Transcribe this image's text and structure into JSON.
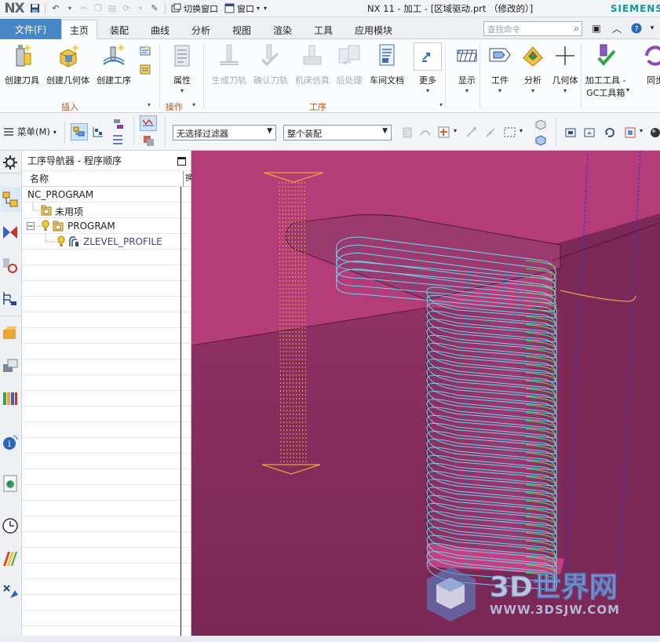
{
  "app": {
    "logo": "NX",
    "window_title": "NX 11 - 加工 - [区域驱动.prt （修改的）]",
    "brand": "SIEMENS"
  },
  "quick_access": {
    "switch_window": "切换窗口",
    "window_menu": "窗口"
  },
  "tabs": {
    "file": "文件(F)",
    "items": [
      "主页",
      "装配",
      "曲线",
      "分析",
      "视图",
      "渲染",
      "工具",
      "应用模块"
    ],
    "active": "主页"
  },
  "command_search": {
    "placeholder": "查找命令"
  },
  "ribbon": {
    "buttons": [
      {
        "label": "创建刀具",
        "icon": "create-tool-icon",
        "enabled": true
      },
      {
        "label": "创建几何体",
        "icon": "create-geometry-icon",
        "enabled": true
      },
      {
        "label": "创建工序",
        "icon": "create-operation-icon",
        "enabled": true
      },
      {
        "label": "属性",
        "icon": "properties-icon",
        "enabled": true
      },
      {
        "label": "生成刀轨",
        "icon": "generate-toolpath-icon",
        "enabled": false
      },
      {
        "label": "确认刀轨",
        "icon": "verify-toolpath-icon",
        "enabled": false
      },
      {
        "label": "机床仿真",
        "icon": "machine-simulation-icon",
        "enabled": false
      },
      {
        "label": "后处理",
        "icon": "postprocess-icon",
        "enabled": false
      },
      {
        "label": "车间文档",
        "icon": "shop-documentation-icon",
        "enabled": true
      },
      {
        "label": "更多",
        "icon": "more-icon",
        "enabled": true
      },
      {
        "label": "显示",
        "icon": "display-icon",
        "enabled": true
      },
      {
        "label": "工件",
        "icon": "workpiece-icon",
        "enabled": true
      },
      {
        "label": "分析",
        "icon": "analysis-icon",
        "enabled": true
      },
      {
        "label": "几何体",
        "icon": "geometry-icon",
        "enabled": true
      },
      {
        "label": "加工工具 -",
        "label2": "GC工具箱",
        "icon": "gc-toolbox-icon",
        "enabled": true
      },
      {
        "label": "同步",
        "icon": "sync-icon",
        "enabled": true
      }
    ],
    "groups": {
      "insert": "插入",
      "operations": "操作",
      "operation": "工序"
    }
  },
  "selection_bar": {
    "menu": "菜单(M)",
    "filter": "无选择过滤器",
    "scope": "整个装配"
  },
  "navigator": {
    "title": "工序导航器 - 程序顺序",
    "column_name": "名称",
    "column_2": "换",
    "rows": [
      {
        "label": "NC_PROGRAM",
        "indent": 0,
        "icon": "none"
      },
      {
        "label": "未用项",
        "indent": 1,
        "icon": "folder-icon"
      },
      {
        "label": "PROGRAM",
        "indent": 1,
        "icon": "program-folder-icon"
      },
      {
        "label": "ZLEVEL_PROFILE",
        "indent": 2,
        "icon": "zlevel-profile-icon"
      }
    ]
  },
  "watermark": {
    "text": "3D世界网",
    "url": "WWW.3DSJW.COM"
  },
  "colors": {
    "file_tab": "#4787c7",
    "active_group_label": "#b7551b",
    "part_face_top": "#b43c78",
    "part_face_front": "#862c5e",
    "part_face_right": "#7a2855",
    "toolpath_cyan": "#6fd2ee",
    "toolpath_green": "#63e05a",
    "toolpath_orange": "#f0a23c",
    "toolpath_blue": "#3030e0",
    "operation_label": "#4b39a8"
  }
}
